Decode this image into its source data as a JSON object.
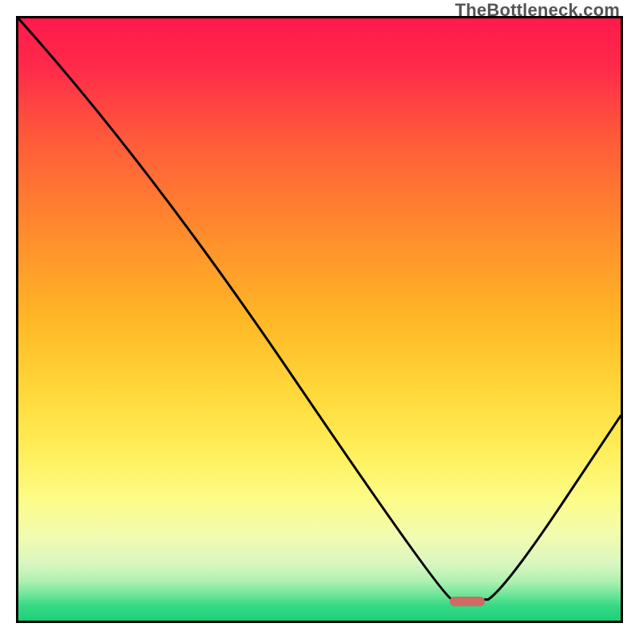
{
  "watermark": "TheBottleneck.com",
  "gradient_stops": [
    {
      "offset": 0.0,
      "color": "#ff1a4b"
    },
    {
      "offset": 0.08,
      "color": "#ff2a4a"
    },
    {
      "offset": 0.2,
      "color": "#ff5a3a"
    },
    {
      "offset": 0.35,
      "color": "#ff8a2d"
    },
    {
      "offset": 0.5,
      "color": "#ffb726"
    },
    {
      "offset": 0.62,
      "color": "#ffd83a"
    },
    {
      "offset": 0.72,
      "color": "#ffef5a"
    },
    {
      "offset": 0.8,
      "color": "#fcfc88"
    },
    {
      "offset": 0.86,
      "color": "#f2fbb0"
    },
    {
      "offset": 0.905,
      "color": "#d9f7c0"
    },
    {
      "offset": 0.935,
      "color": "#aef0b0"
    },
    {
      "offset": 0.958,
      "color": "#6be598"
    },
    {
      "offset": 0.975,
      "color": "#37d985"
    },
    {
      "offset": 1.0,
      "color": "#1fcf78"
    }
  ],
  "marker": {
    "x_frac": 0.745,
    "y_frac": 0.968,
    "color": "#cf6a64"
  },
  "chart_data": {
    "type": "line",
    "title": "",
    "xlabel": "",
    "ylabel": "",
    "xlim": [
      0,
      1
    ],
    "ylim": [
      0,
      1
    ],
    "series": [
      {
        "name": "bottleneck-curve",
        "points": [
          {
            "x": 0.0,
            "y": 1.0
          },
          {
            "x": 0.215,
            "y": 0.76
          },
          {
            "x": 0.7,
            "y": 0.045
          },
          {
            "x": 0.72,
            "y": 0.035
          },
          {
            "x": 0.78,
            "y": 0.035
          },
          {
            "x": 0.81,
            "y": 0.055
          },
          {
            "x": 1.0,
            "y": 0.34
          }
        ]
      }
    ],
    "optimal_region": {
      "x_start": 0.72,
      "x_end": 0.78
    }
  }
}
